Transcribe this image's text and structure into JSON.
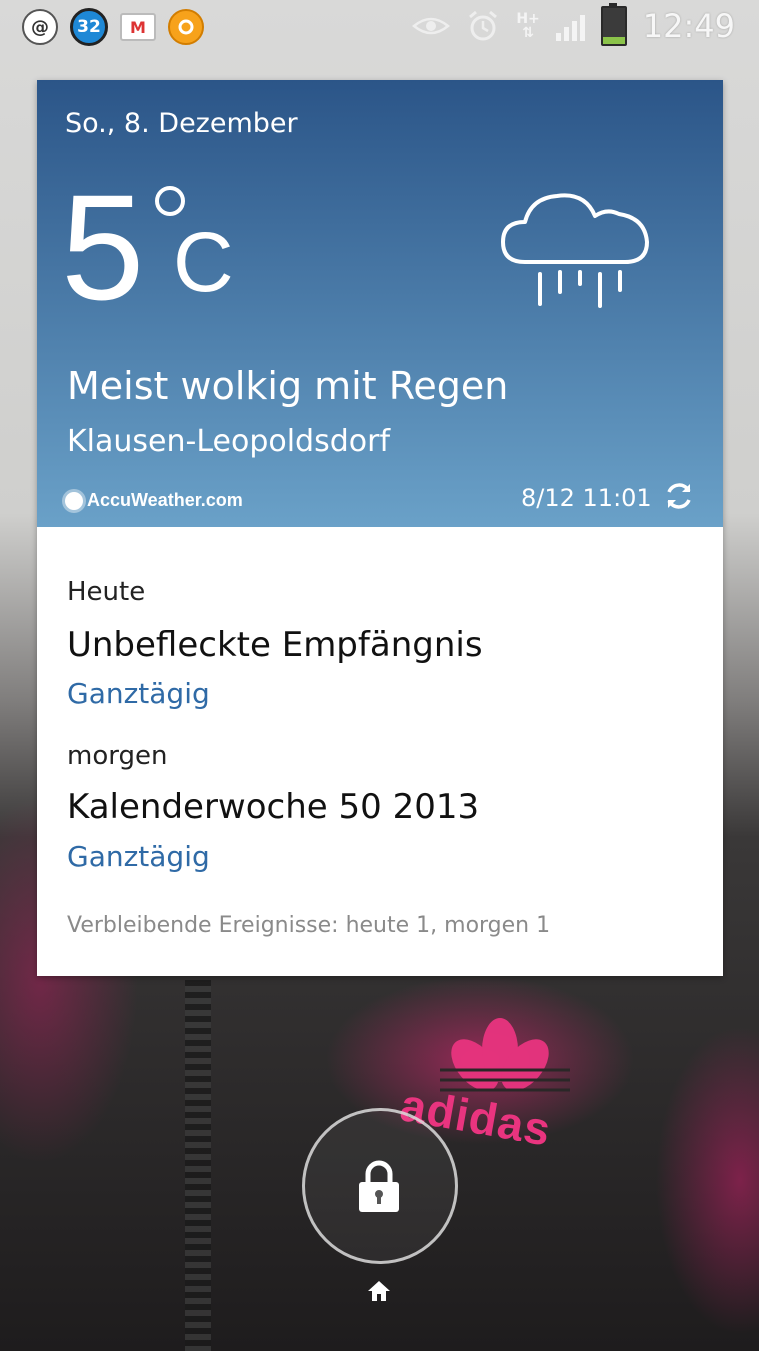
{
  "status_bar": {
    "notif_cal_count": "32",
    "time": "12:49",
    "network": "H+",
    "battery_level": 0.2
  },
  "weather": {
    "date": "So., 8. Dezember",
    "temperature": "5",
    "unit": "C",
    "condition": "Meist wolkig mit Regen",
    "location": "Klausen-Leopoldsdorf",
    "brand": "AccuWeather.com",
    "updated": "8/12 11:01",
    "icon": "cloud-rain-icon",
    "gradient_top": "#2b5588",
    "gradient_bottom": "#6aa1c8"
  },
  "calendar": {
    "today_header": "Heute",
    "today_event": "Unbefleckte Empfängnis",
    "today_event_time": "Ganztägig",
    "tomorrow_header": "morgen",
    "tomorrow_event": "Kalenderwoche 50 2013",
    "tomorrow_event_time": "Ganztägig",
    "remaining": "Verbleibende Ereignisse: heute 1, morgen 1",
    "accent": "#2f6aa6"
  },
  "wallpaper": {
    "logo_text": "adidas"
  }
}
